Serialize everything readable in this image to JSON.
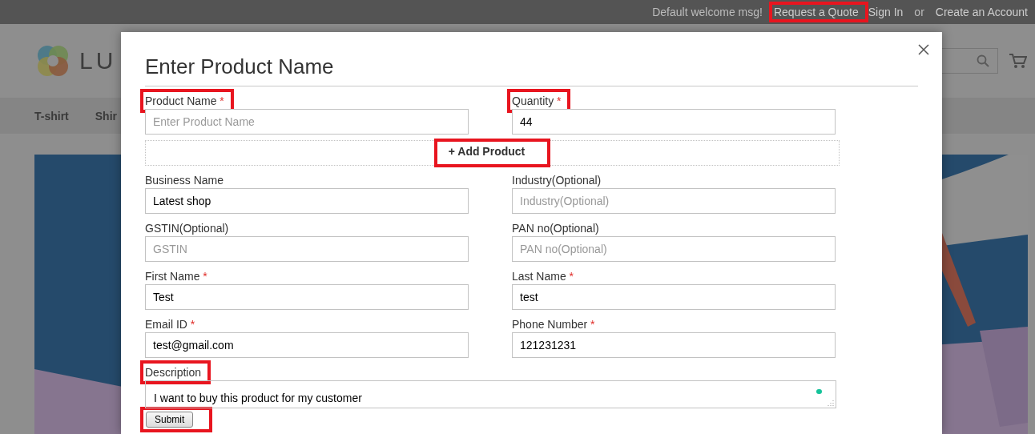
{
  "top_links": [
    {
      "text": "Default welcome msg!",
      "kind": "text",
      "highlighted": false
    },
    {
      "text": "Request a Quote",
      "kind": "link",
      "highlighted": true
    },
    {
      "text": "Sign In",
      "kind": "link",
      "highlighted": false
    },
    {
      "text": "or",
      "kind": "text",
      "highlighted": false
    },
    {
      "text": "Create an Account",
      "kind": "link",
      "highlighted": false
    }
  ],
  "logo": {
    "text": "LU"
  },
  "nav": [
    "T-shirt",
    "Shir"
  ],
  "modal": {
    "title": "Enter Product Name",
    "product_row": [
      {
        "label": "Product Name",
        "required_mark": "*",
        "placeholder": "Enter Product Name",
        "highlighted": true
      },
      {
        "label": "Quantity",
        "required_mark": "*",
        "value": "44",
        "highlighted": true
      }
    ],
    "add_product": {
      "text": "+ Add Product",
      "highlighted": true
    },
    "details": [
      {
        "label": "Business Name",
        "value": "Latest shop"
      },
      {
        "label": "Industry(Optional)",
        "placeholder": "Industry(Optional)"
      },
      {
        "label": "GSTIN(Optional)",
        "placeholder": "GSTIN"
      },
      {
        "label": "PAN no(Optional)",
        "placeholder": "PAN no(Optional)"
      },
      {
        "label": "First Name",
        "required_mark": "*",
        "value": "Test"
      },
      {
        "label": "Last Name",
        "required_mark": "*",
        "value": "test"
      },
      {
        "label": "Email ID",
        "required_mark": "*",
        "value": "test@gmail.com"
      },
      {
        "label": "Phone Number",
        "required_mark": "*",
        "value": "121231231"
      }
    ],
    "description": {
      "label": "Description",
      "value": "I want to buy this product for my customer",
      "highlighted": true
    },
    "submit": {
      "text": "Submit",
      "highlighted": true
    }
  }
}
